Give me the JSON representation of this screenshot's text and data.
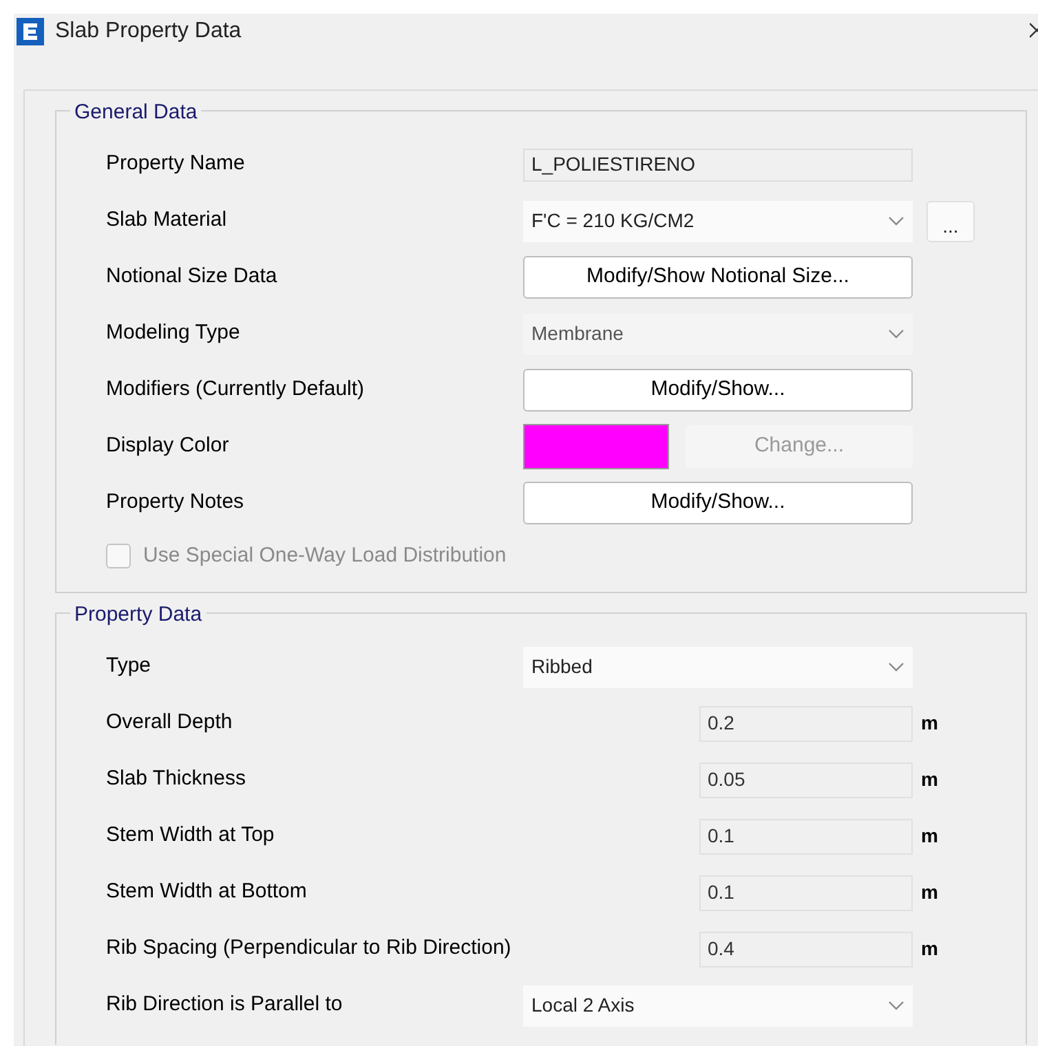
{
  "window": {
    "title": "Slab Property Data"
  },
  "general_data": {
    "title": "General Data",
    "rows": [
      {
        "kind": "field",
        "label": "Property Name",
        "value": "L_POLIESTIRENO"
      },
      {
        "kind": "combo",
        "label": "Slab Material",
        "value": "F'C = 210 KG/CM2",
        "disabled": false,
        "extra_button": "..."
      },
      {
        "kind": "button",
        "label": "Notional Size Data",
        "button": "Modify/Show Notional Size..."
      },
      {
        "kind": "combo",
        "label": "Modeling Type",
        "value": "Membrane",
        "disabled": true
      },
      {
        "kind": "button",
        "label": "Modifiers (Currently Default)",
        "button": "Modify/Show..."
      },
      {
        "kind": "color",
        "label": "Display Color",
        "color": "#ff00ff",
        "button": "Change...",
        "disabled": true
      },
      {
        "kind": "button",
        "label": "Property Notes",
        "button": "Modify/Show..."
      }
    ],
    "checkbox": {
      "label": "Use Special One-Way Load Distribution",
      "checked": false,
      "disabled": true
    }
  },
  "property_data": {
    "title": "Property Data",
    "rows": [
      {
        "kind": "combo",
        "label": "Type",
        "value": "Ribbed",
        "disabled": false
      },
      {
        "kind": "number",
        "label": "Overall Depth",
        "value": "0.2",
        "unit": "m"
      },
      {
        "kind": "number",
        "label": "Slab Thickness",
        "value": "0.05",
        "unit": "m"
      },
      {
        "kind": "number",
        "label": "Stem Width at Top",
        "value": "0.1",
        "unit": "m"
      },
      {
        "kind": "number",
        "label": "Stem Width at Bottom",
        "value": "0.1",
        "unit": "m"
      },
      {
        "kind": "number",
        "label": "Rib Spacing (Perpendicular to Rib Direction)",
        "value": "0.4",
        "unit": "m"
      },
      {
        "kind": "combo",
        "label": "Rib Direction is Parallel to",
        "value": "Local 2 Axis",
        "disabled": false
      }
    ]
  }
}
